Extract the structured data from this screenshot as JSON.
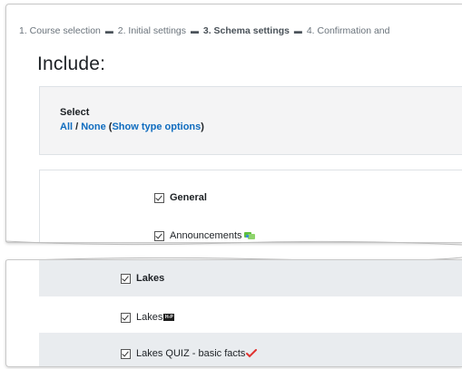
{
  "breadcrumb": {
    "step1": "1. Course selection",
    "step2": "2. Initial settings",
    "step3": "3. Schema settings",
    "step4": "4. Confirmation and",
    "separator": "▬"
  },
  "page": {
    "title": "Include:"
  },
  "select": {
    "label": "Select",
    "all": "All",
    "slash": " / ",
    "none": "None",
    "open_paren": " (",
    "type_options": "Show type options",
    "close_paren": ")"
  },
  "items": {
    "general": "General",
    "announcements": "Announcements",
    "lakes_section": "Lakes",
    "lakes_activity": "Lakes",
    "h5p_badge": "H-P",
    "lakes_quiz": "Lakes QUIZ - basic facts"
  },
  "colors": {
    "link": "#0f6cbf",
    "panel_bg": "#f4f4f5",
    "row_alt_bg": "#e9ecef",
    "announcement_icon": "#5fbf3f",
    "quiz_icon": "#e0322f"
  }
}
